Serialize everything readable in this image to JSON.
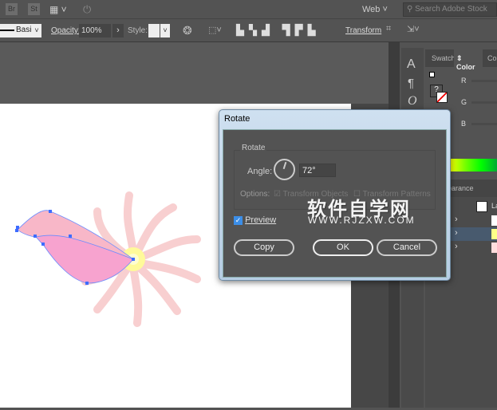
{
  "menubar": {
    "br": "Br",
    "st": "St",
    "workspace": "Web",
    "search_placeholder": "Search Adobe Stock"
  },
  "control": {
    "stroke_profile": "Basic",
    "opacity_label": "Opacity:",
    "opacity_value": "100%",
    "style_label": "Style:",
    "transform_label": "Transform"
  },
  "panels": {
    "tab_swatch": "Swatch",
    "tab_color": "Color",
    "tab_more": "Co",
    "r": "R",
    "g": "G",
    "b": "B",
    "appearance": "Appearance",
    "layer_name": "La",
    "type_icons": [
      "A",
      "¶",
      "O"
    ]
  },
  "dialog": {
    "title": "Rotate",
    "group": "Rotate",
    "angle_label": "Angle:",
    "angle_value": "72°",
    "options_label": "Options:",
    "transform_objects": "Transform Objects",
    "transform_patterns": "Transform Patterns",
    "preview": "Preview",
    "preview_checked": true,
    "copy": "Copy",
    "ok": "OK",
    "cancel": "Cancel"
  },
  "watermark": {
    "title": "软件自学网",
    "url": "WWW.RJZXW.COM"
  }
}
